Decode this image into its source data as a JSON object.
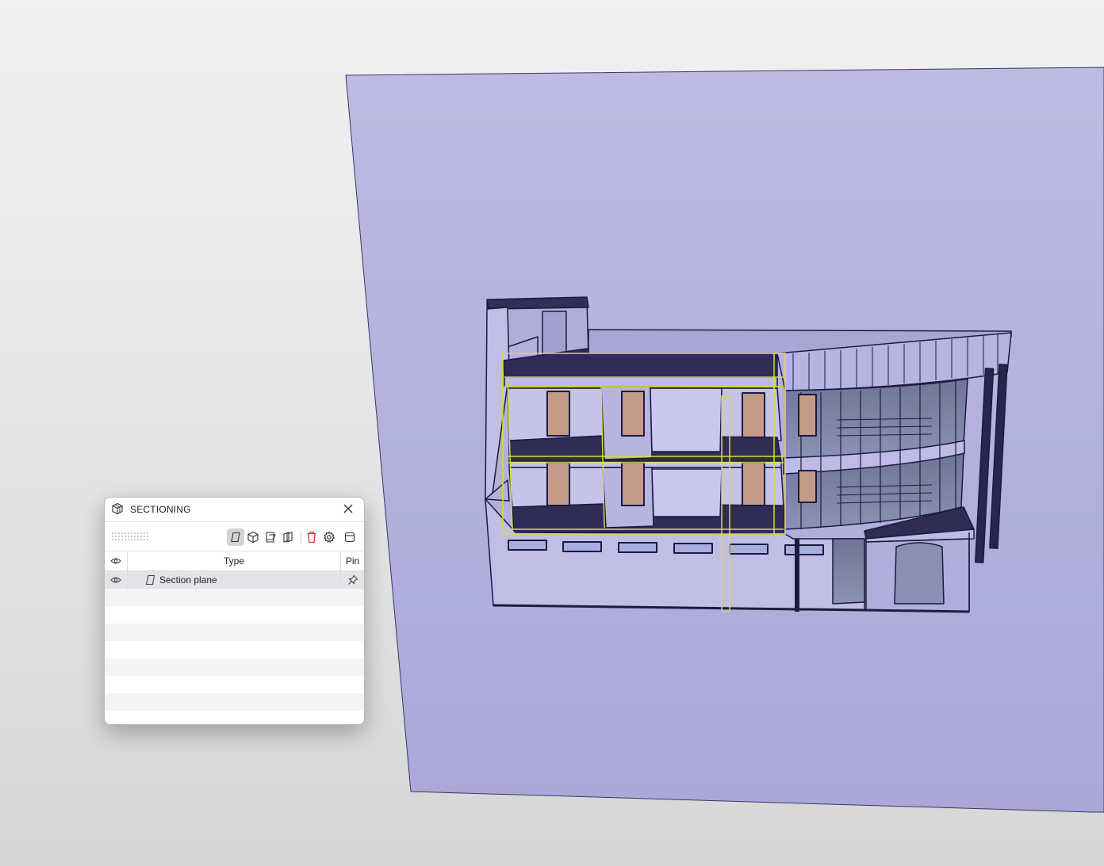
{
  "panel": {
    "title": "SECTIONING",
    "title_icon": "section-box-icon",
    "toolbar": [
      {
        "name": "add-section-plane-button",
        "icon": "section-plane-icon",
        "active": true
      },
      {
        "name": "add-section-box-button",
        "icon": "section-box-icon",
        "active": false
      },
      {
        "name": "add-section-plane-on-face-button",
        "icon": "plane-on-face-icon",
        "active": false
      },
      {
        "name": "add-parallel-planes-button",
        "icon": "parallel-planes-icon",
        "active": false
      },
      {
        "name": "delete-button",
        "icon": "trash-icon",
        "active": false
      },
      {
        "name": "settings-button",
        "icon": "gear-icon",
        "active": false
      },
      {
        "name": "toggle-panel-button",
        "icon": "panel-icon",
        "active": false
      }
    ],
    "columns": {
      "visibility_icon": "eye-icon",
      "type": "Type",
      "pin": "Pin"
    },
    "rows": [
      {
        "visible": true,
        "icon": "section-plane-icon",
        "type": "Section plane",
        "pinned": false,
        "selected": true
      }
    ],
    "empty_rows": 8
  },
  "viewport": {
    "section_plane_color": "#b5b3e0",
    "model_outline_color": "#1c1a40",
    "highlight_color": "#d8dc3a",
    "door_color": "#c49a88"
  }
}
